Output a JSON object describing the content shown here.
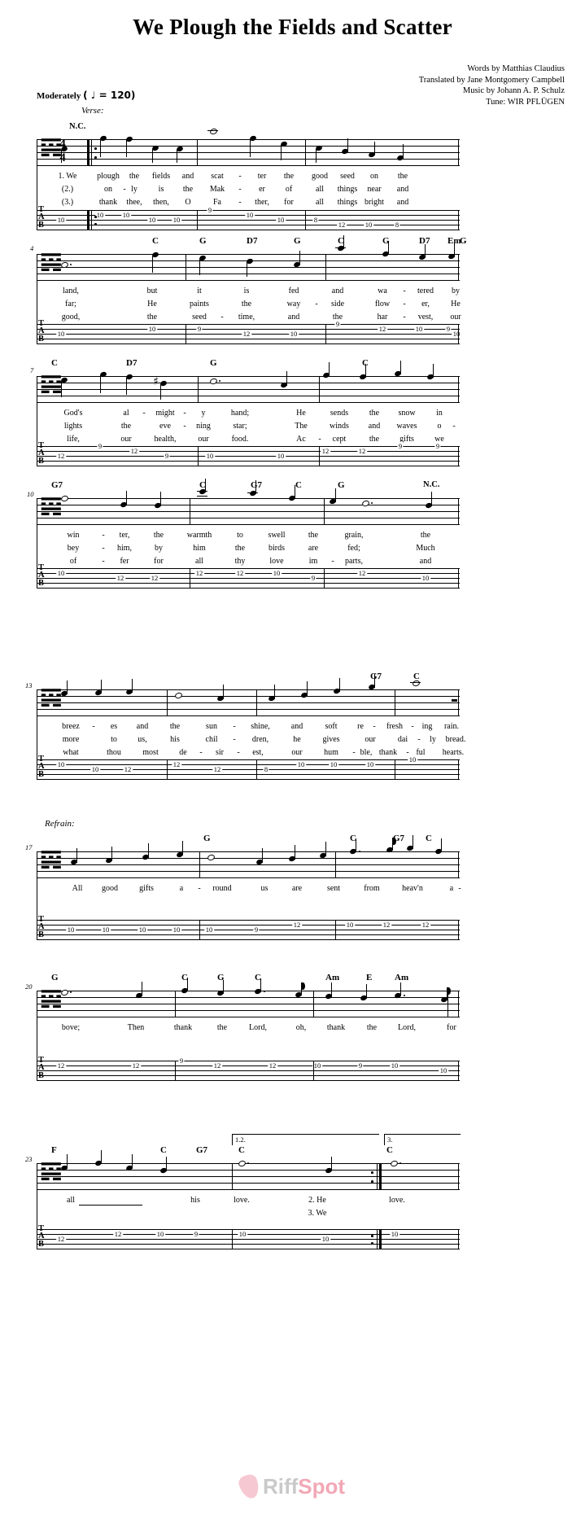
{
  "title": "We Plough the Fields and Scatter",
  "credits": [
    "Words by Matthias Claudius",
    "Translated by Jane Montgomery Campbell",
    "Music by Johann A. P. Schulz",
    "Tune: WIR PFLÜGEN"
  ],
  "tempo": {
    "text": "Moderately",
    "marking": "( ♩ = 120)",
    "bpm": "120"
  },
  "section_labels": {
    "verse": "Verse:",
    "refrain": "Refrain:"
  },
  "clef": "𝌙",
  "time_signature": {
    "top": "4",
    "bottom": "4"
  },
  "tab_clef_letters": "TAB",
  "logo": {
    "part1": "Riff",
    "part2": "Spot"
  },
  "endings": {
    "first": "1.2.",
    "second": "3."
  },
  "systems": [
    {
      "measure_number": "",
      "chords": [
        "N.C."
      ],
      "lyrics": [
        [
          "1. We",
          "plough",
          "the",
          "fields",
          "and",
          "scat",
          "-",
          "ter",
          "the",
          "good",
          "seed",
          "on",
          "the"
        ],
        [
          "(2.)",
          "on",
          "-",
          "ly",
          "is",
          "the",
          "Mak",
          "-",
          "er",
          "of",
          "all",
          "things",
          "near",
          "and"
        ],
        [
          "(3.)",
          "thank",
          "thee,",
          "then,",
          "O",
          "Fa",
          "-",
          "ther,",
          "for",
          "all",
          "things",
          "bright",
          "and"
        ]
      ],
      "tab": [
        "10",
        "10",
        "10",
        "10",
        "10",
        "9",
        "10",
        "10",
        "8",
        "12",
        "10",
        "8"
      ]
    },
    {
      "measure_number": "4",
      "chords": [
        "C",
        "G",
        "D7",
        "G",
        "C",
        "G",
        "D7",
        "Em",
        "G"
      ],
      "lyrics": [
        [
          "land,",
          "but",
          "it",
          "is",
          "fed",
          "and",
          "wa",
          "-",
          "tered",
          "by"
        ],
        [
          "far;",
          "He",
          "paints",
          "the",
          "way",
          "-",
          "side",
          "flow",
          "-",
          "er,",
          "He"
        ],
        [
          "good,",
          "the",
          "seed",
          "-",
          "time,",
          "and",
          "the",
          "har",
          "-",
          "vest,",
          "our"
        ]
      ],
      "tab": [
        "10",
        "10",
        "9",
        "12",
        "10",
        "9",
        "12",
        "10",
        "9",
        "10"
      ]
    },
    {
      "measure_number": "7",
      "chords": [
        "C",
        "D7",
        "G",
        "C"
      ],
      "lyrics": [
        [
          "God's",
          "al",
          "-",
          "might",
          "-",
          "y",
          "hand;",
          "He",
          "sends",
          "the",
          "snow",
          "in"
        ],
        [
          "lights",
          "the",
          "eve",
          "-",
          "ning",
          "star;",
          "The",
          "winds",
          "and",
          "waves",
          "o",
          "-"
        ],
        [
          "life,",
          "our",
          "health,",
          "our",
          "food.",
          "Ac",
          "-",
          "cept",
          "the",
          "gifts",
          "we"
        ]
      ],
      "tab": [
        "12",
        "9",
        "12",
        "9",
        "10",
        "10",
        "12",
        "12",
        "9",
        "9"
      ]
    },
    {
      "measure_number": "10",
      "chords": [
        "G7",
        "C",
        "G7",
        "C",
        "G",
        "N.C."
      ],
      "lyrics": [
        [
          "win",
          "-",
          "ter,",
          "the",
          "warmth",
          "to",
          "swell",
          "the",
          "grain,",
          "the"
        ],
        [
          "bey",
          "-",
          "him,",
          "by",
          "him",
          "the",
          "birds",
          "are",
          "fed;",
          "Much"
        ],
        [
          "of",
          "-",
          "fer",
          "for",
          "all",
          "thy",
          "love",
          "im",
          "-",
          "parts,",
          "and"
        ]
      ],
      "tab": [
        "10",
        "12",
        "12",
        "12",
        "12",
        "10",
        "9",
        "12",
        "10"
      ]
    },
    {
      "measure_number": "13",
      "chords": [
        "G7",
        "C"
      ],
      "lyrics": [
        [
          "breez",
          "-",
          "es",
          "and",
          "the",
          "sun",
          "-",
          "shine,",
          "and",
          "soft",
          "re",
          "-",
          "fresh",
          "-",
          "ing",
          "rain."
        ],
        [
          "more",
          "to",
          "us,",
          "his",
          "chil",
          "-",
          "dren,",
          "he",
          "gives",
          "our",
          "dai",
          "-",
          "ly",
          "bread."
        ],
        [
          "what",
          "thou",
          "most",
          "de",
          "-",
          "sir",
          "-",
          "est,",
          "our",
          "hum",
          "-",
          "ble,",
          "thank",
          "-",
          "ful",
          "hearts."
        ]
      ],
      "tab": [
        "10",
        "10",
        "12",
        "12",
        "12",
        "8",
        "10",
        "10",
        "10"
      ]
    },
    {
      "measure_number": "17",
      "chords": [
        "G",
        "C",
        "G7",
        "C"
      ],
      "lyrics": [
        [
          "All",
          "good",
          "gifts",
          "a",
          "-",
          "round",
          "us",
          "are",
          "sent",
          "from",
          "heav'n",
          "a",
          "-"
        ]
      ],
      "tab": [
        "10",
        "10",
        "10",
        "10",
        "10",
        "9",
        "12",
        "10",
        "12"
      ]
    },
    {
      "measure_number": "20",
      "chords": [
        "G",
        "C",
        "G",
        "C",
        "Am",
        "E",
        "Am"
      ],
      "lyrics": [
        [
          "bove;",
          "Then",
          "thank",
          "the",
          "Lord,",
          "oh,",
          "thank",
          "the",
          "Lord,",
          "for"
        ]
      ],
      "tab": [
        "12",
        "12",
        "9",
        "12",
        "12",
        "10",
        "9",
        "10",
        "10"
      ]
    },
    {
      "measure_number": "23",
      "chords": [
        "F",
        "C",
        "G7",
        "C",
        "C"
      ],
      "lyrics": [
        [
          "all",
          "his",
          "love.",
          "2.  He",
          "love."
        ],
        [
          "3.  We"
        ]
      ],
      "tab": [
        "12",
        "12",
        "10",
        "9",
        "10",
        "10",
        "10"
      ]
    }
  ]
}
